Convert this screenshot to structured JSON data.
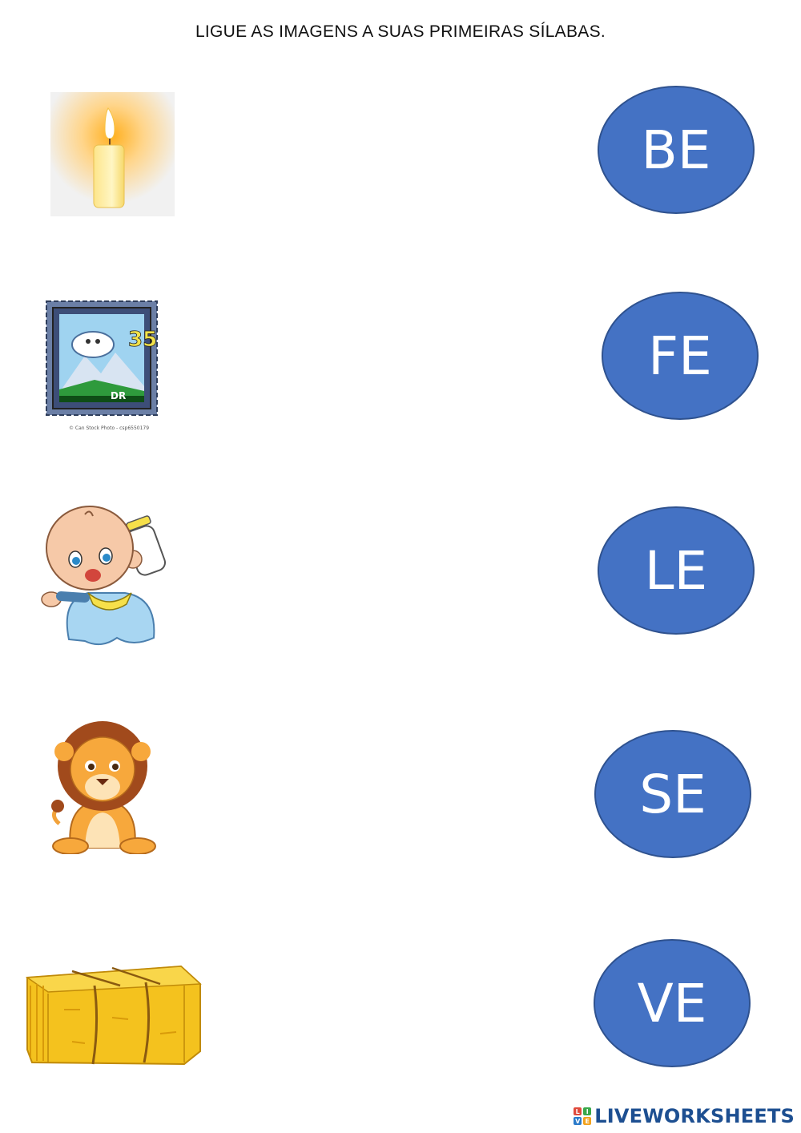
{
  "instruction": "LIGUE AS IMAGENS A SUAS PRIMEIRAS SÍLABAS.",
  "pictures": [
    {
      "icon": "candle-icon"
    },
    {
      "icon": "stamp-icon",
      "stamp_value": "35",
      "stamp_text": "DR",
      "credit": "© Can Stock Photo - csp6550179"
    },
    {
      "icon": "baby-icon"
    },
    {
      "icon": "lion-icon"
    },
    {
      "icon": "hay-bale-icon"
    }
  ],
  "syllables": [
    "BE",
    "FE",
    "LE",
    "SE",
    "VE"
  ],
  "brand": {
    "name": "LIVEWORKSHEETS",
    "logo_letters": [
      "L",
      "I",
      "V",
      "E"
    ],
    "colors": {
      "text": "#1d4f91",
      "oval": "#4472c4"
    }
  }
}
